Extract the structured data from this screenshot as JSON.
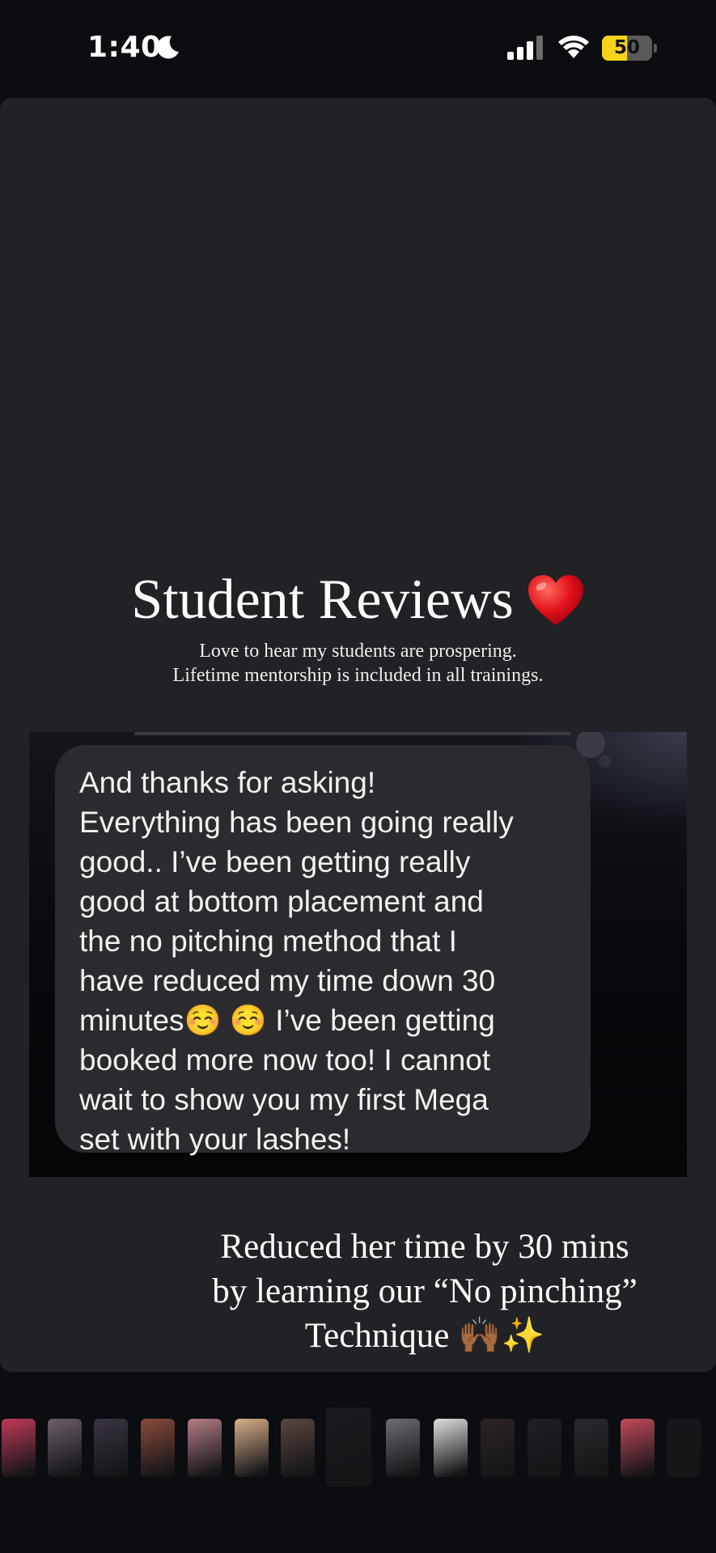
{
  "status_bar": {
    "time": "1:40",
    "battery_level": "50",
    "battery_fraction": 0.5,
    "icons": [
      "moon-icon",
      "cellular-signal-icon",
      "wifi-icon",
      "battery-icon"
    ]
  },
  "story": {
    "title": "Student Reviews",
    "title_emoji": "heart-emoji",
    "subtitle_lines": [
      "Love to hear my students are prospering.",
      "Lifetime mentorship is included in all trainings."
    ],
    "message_lines": [
      "And thanks for asking!",
      "Everything has been going really",
      "good.. I’ve been getting really",
      "good at bottom placement and",
      "the no pitching method that I",
      "have reduced my time down 30",
      "minutes☺️ ☺️ I’ve been getting",
      "booked more now too! I cannot",
      "wait to show you my first Mega",
      "set with your lashes!"
    ],
    "caption_lines": [
      "Reduced her time by 30 mins",
      "by learning our “No pinching”",
      "Technique 🙌🏾✨"
    ]
  },
  "thumbnails": {
    "active_index": 7,
    "colors": [
      "#c23a5c",
      "#6b5f6a",
      "#3a3440",
      "#8a4a3c",
      "#b57d86",
      "#d9b08a",
      "#5a4640",
      "#1a1a1e",
      "#6d6d72",
      "#e0e0e0",
      "#2c2426",
      "#1f1f24",
      "#2a2a2e",
      "#c44a5a",
      "#16161a"
    ]
  }
}
